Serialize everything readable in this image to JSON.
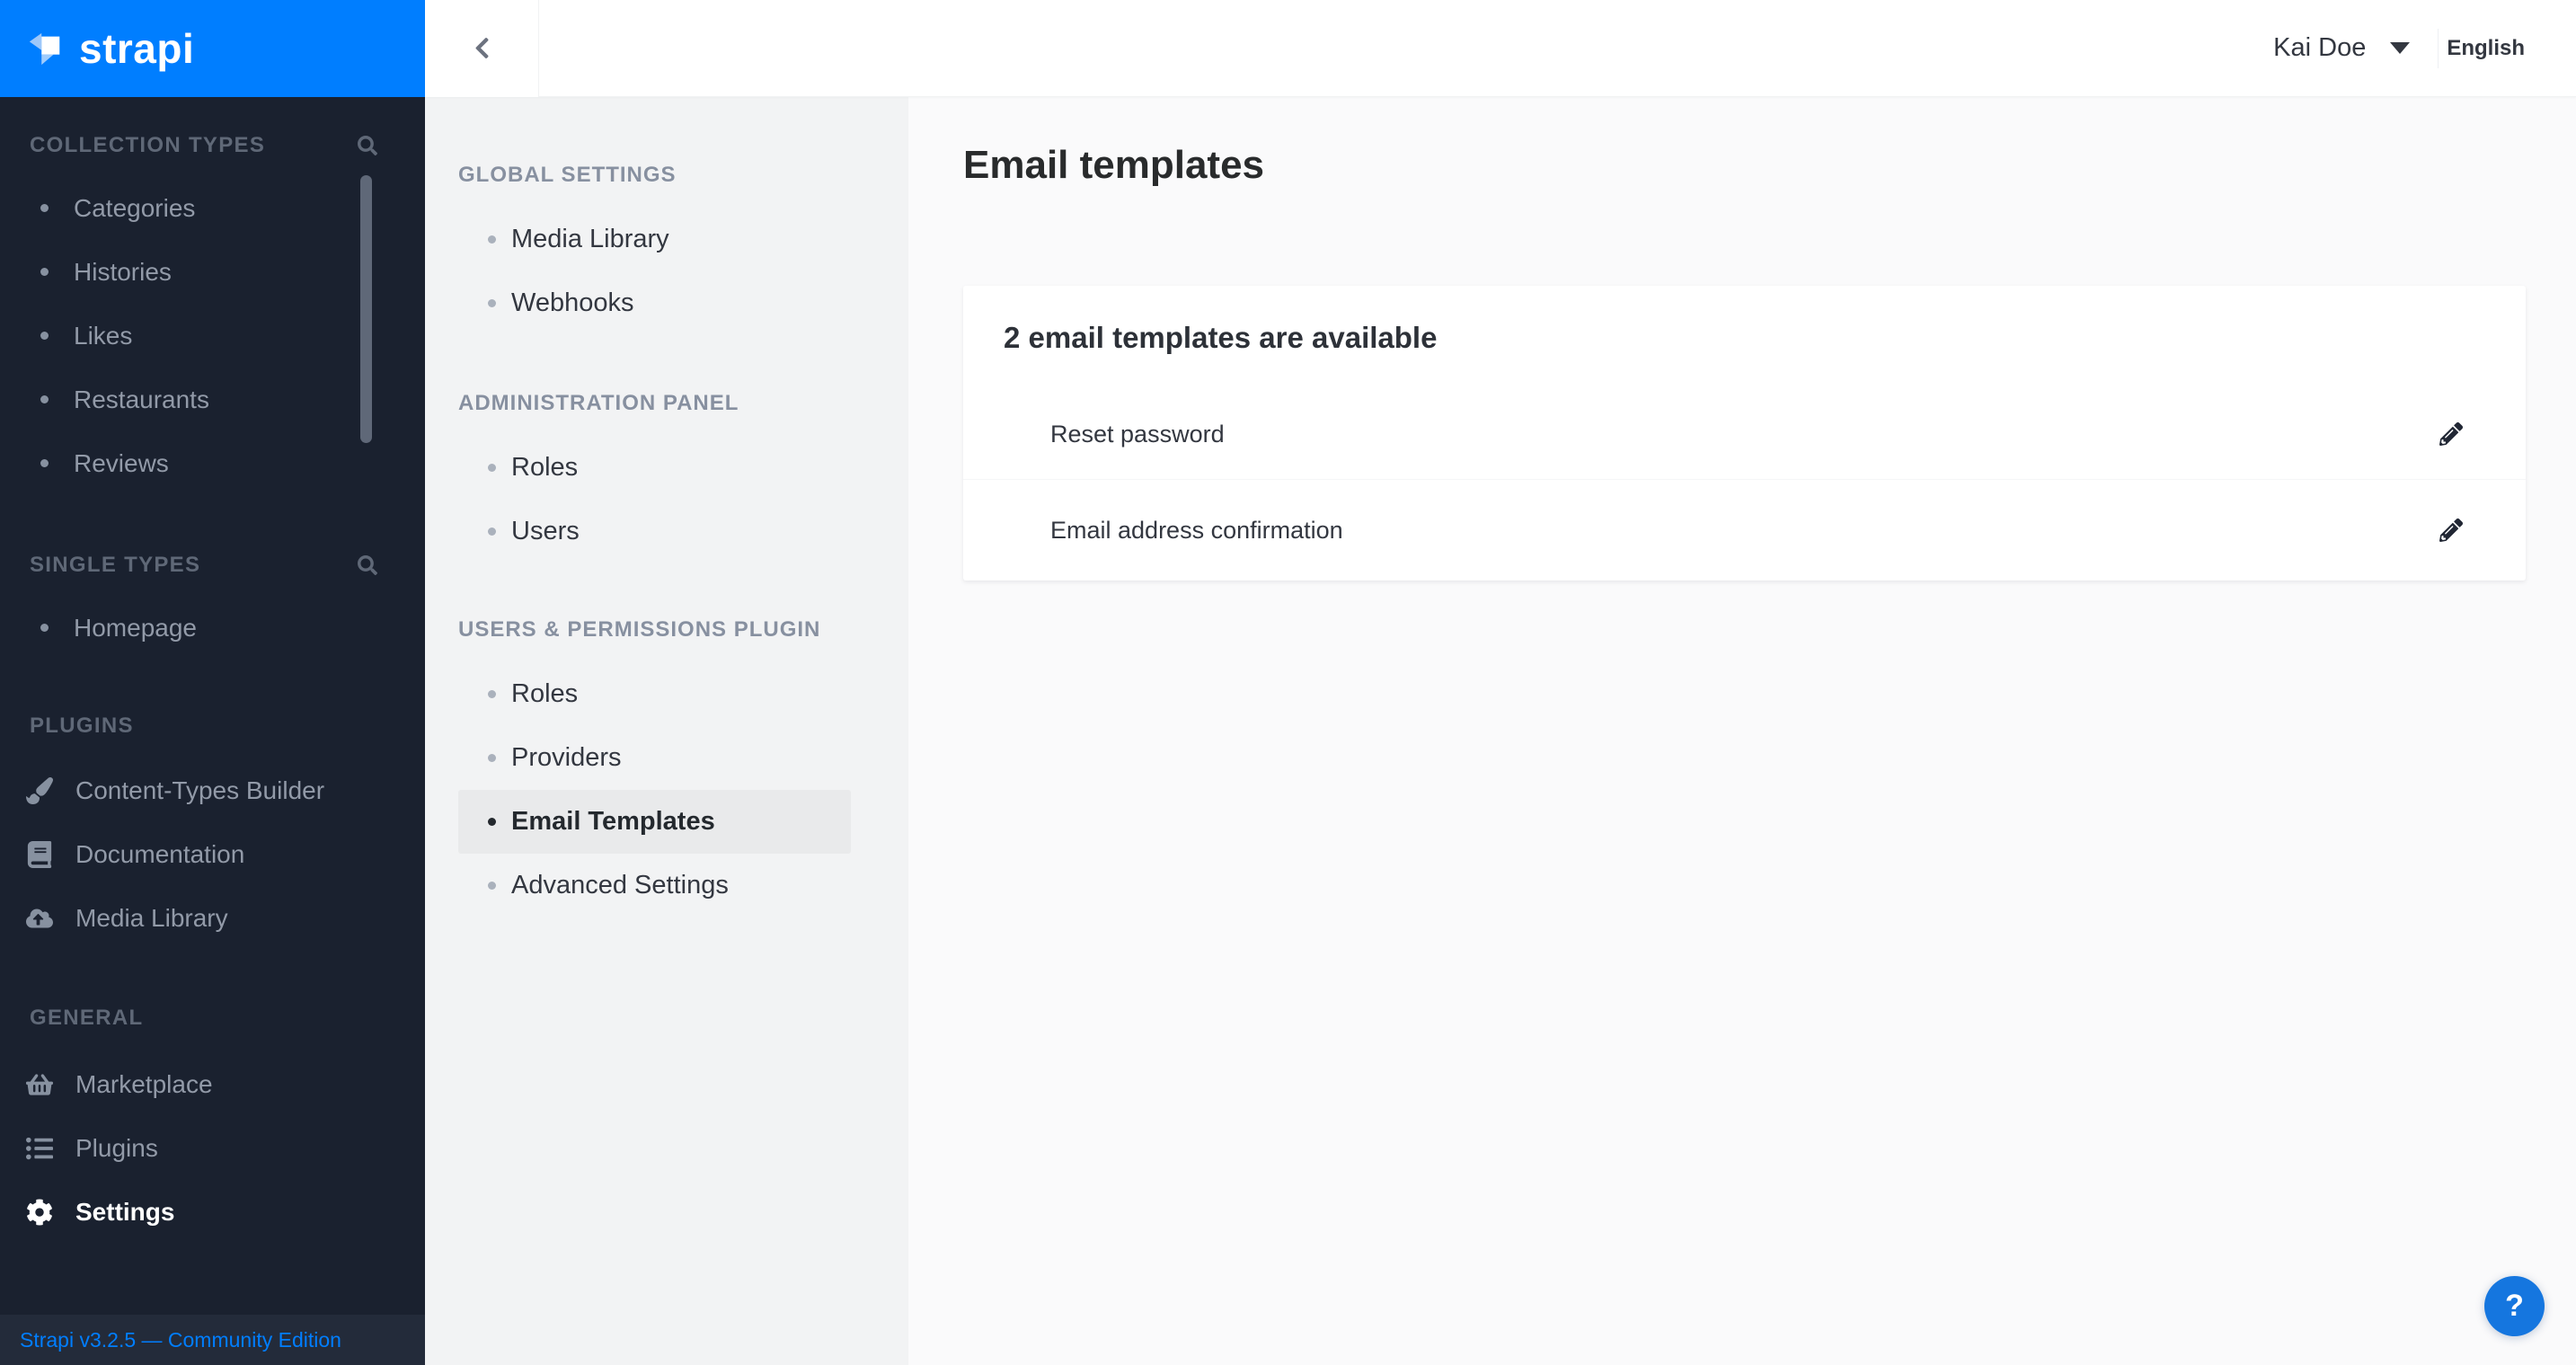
{
  "brand": {
    "logo_text": "strapi",
    "accent_color": "#007eff"
  },
  "sidebar": {
    "collection_types": {
      "title": "COLLECTION TYPES",
      "search_icon": "search-icon",
      "items": [
        {
          "label": "Categories"
        },
        {
          "label": "Histories"
        },
        {
          "label": "Likes"
        },
        {
          "label": "Restaurants"
        },
        {
          "label": "Reviews"
        }
      ]
    },
    "single_types": {
      "title": "SINGLE TYPES",
      "search_icon": "search-icon",
      "items": [
        {
          "label": "Homepage"
        }
      ]
    },
    "plugins_section": {
      "title": "PLUGINS",
      "items": [
        {
          "label": "Content-Types Builder",
          "icon": "paint-brush-icon"
        },
        {
          "label": "Documentation",
          "icon": "book-icon"
        },
        {
          "label": "Media Library",
          "icon": "cloud-upload-icon"
        }
      ]
    },
    "general_section": {
      "title": "GENERAL",
      "items": [
        {
          "label": "Marketplace",
          "icon": "shopping-basket-icon"
        },
        {
          "label": "Plugins",
          "icon": "list-icon"
        },
        {
          "label": "Settings",
          "icon": "gear-icon",
          "active": true
        }
      ]
    },
    "footer": {
      "version_text": "Strapi v3.2.5 — Community Edition"
    }
  },
  "topbar": {
    "back_icon": "chevron-left-icon",
    "user_name": "Kai Doe",
    "language": "English"
  },
  "settings_nav": {
    "global_settings": {
      "title": "GLOBAL SETTINGS",
      "items": [
        {
          "label": "Media Library"
        },
        {
          "label": "Webhooks"
        }
      ]
    },
    "administration_panel": {
      "title": "ADMINISTRATION PANEL",
      "items": [
        {
          "label": "Roles"
        },
        {
          "label": "Users"
        }
      ]
    },
    "users_permissions": {
      "title": "USERS & PERMISSIONS PLUGIN",
      "items": [
        {
          "label": "Roles"
        },
        {
          "label": "Providers"
        },
        {
          "label": "Email Templates",
          "active": true
        },
        {
          "label": "Advanced Settings"
        }
      ]
    }
  },
  "main": {
    "page_title": "Email templates",
    "card": {
      "title": "2 email templates are available",
      "rows": [
        {
          "label": "Reset password",
          "action_icon": "pencil-icon"
        },
        {
          "label": "Email address confirmation",
          "action_icon": "pencil-icon"
        }
      ]
    }
  },
  "help": {
    "label": "?",
    "color": "#1576df"
  }
}
